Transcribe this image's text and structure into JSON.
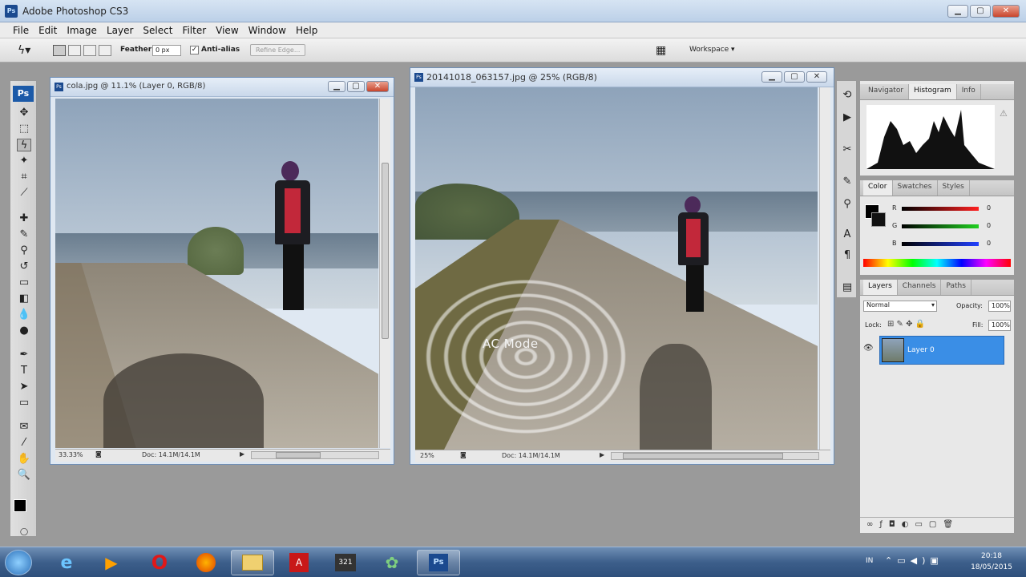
{
  "app": {
    "title": "Adobe Photoshop CS3",
    "logo": "Ps"
  },
  "menu": [
    "File",
    "Edit",
    "Image",
    "Layer",
    "Select",
    "Filter",
    "View",
    "Window",
    "Help"
  ],
  "options_bar": {
    "feather_label": "Feather:",
    "feather_value": "0 px",
    "antialias_label": "Anti-alias",
    "antialias_checked": true,
    "refine_edge_label": "Refine Edge...",
    "workspace_label": "Workspace ▾"
  },
  "doc1": {
    "title": "cola.jpg @ 11.1% (Layer 0, RGB/8)",
    "zoom": "33.33%",
    "info": "Doc: 14.1M/14.1M"
  },
  "doc2": {
    "title": "20141018_063157.jpg @ 25% (RGB/8)",
    "zoom": "25%",
    "info": "Doc: 14.1M/14.1M",
    "overlay_text": "AC Mode"
  },
  "navigator_panel": {
    "tabs": [
      "Navigator",
      "Histogram",
      "Info"
    ],
    "active_tab": "Histogram"
  },
  "color_panel": {
    "tabs": [
      "Color",
      "Swatches",
      "Styles"
    ],
    "active_tab": "Color",
    "channels": [
      {
        "label": "R",
        "value": "0",
        "color": "#e03030"
      },
      {
        "label": "G",
        "value": "0",
        "color": "#30b030"
      },
      {
        "label": "B",
        "value": "0",
        "color": "#3050e0"
      }
    ]
  },
  "layers_panel": {
    "tabs": [
      "Layers",
      "Channels",
      "Paths"
    ],
    "active_tab": "Layers",
    "blend_mode": "Normal",
    "opacity_label": "Opacity:",
    "opacity": "100%",
    "lock_label": "Lock:",
    "fill_label": "Fill:",
    "fill": "100%",
    "layers": [
      {
        "name": "Layer 0",
        "visible": true
      }
    ]
  },
  "taskbar": {
    "language": "IN",
    "time": "20:18",
    "date": "18/05/2015",
    "apps": [
      "start-orb",
      "internet-explorer",
      "media-player",
      "opera",
      "firefox",
      "file-explorer",
      "acrobat-reader",
      "media-player-classic",
      "network-app",
      "photoshop"
    ]
  },
  "colors": {
    "accent": "#3a8ee6",
    "ps_blue": "#1b4a8f",
    "workspace_bg": "#9a9a9a"
  }
}
